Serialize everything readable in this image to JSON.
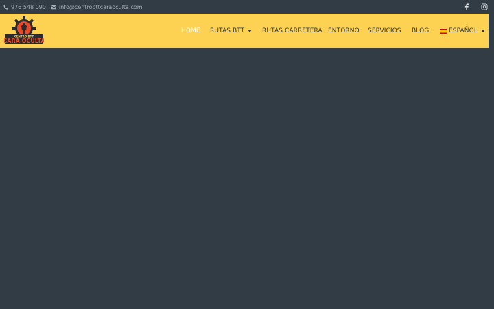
{
  "topbar": {
    "phone": "976 548 090",
    "email": "info@centrobttcaraoculta.com",
    "phone_icon": "phone-icon",
    "email_icon": "envelope-icon"
  },
  "socials": [
    {
      "icon": "facebook-icon"
    },
    {
      "icon": "instagram-icon"
    }
  ],
  "logo": {
    "line1": "CENTRO BTT",
    "line2": "CARA OCULTA"
  },
  "nav": {
    "items": [
      {
        "label": "HOME",
        "active": true
      },
      {
        "label": "RUTAS BTT",
        "dropdown": true
      },
      {
        "label": "RUTAS CARRETERA"
      },
      {
        "label": "ENTORNO"
      },
      {
        "label": "SERVICIOS"
      },
      {
        "label": "BLOG"
      },
      {
        "label": "ESPAÑOL",
        "dropdown": true,
        "flag": "spain-flag-icon"
      }
    ]
  },
  "colors": {
    "header_bg": "#fdd152",
    "page_bg": "#323c45",
    "nav_text": "#2f3a42",
    "nav_active": "#ffffff",
    "logo_accent": "#e84b2b"
  }
}
